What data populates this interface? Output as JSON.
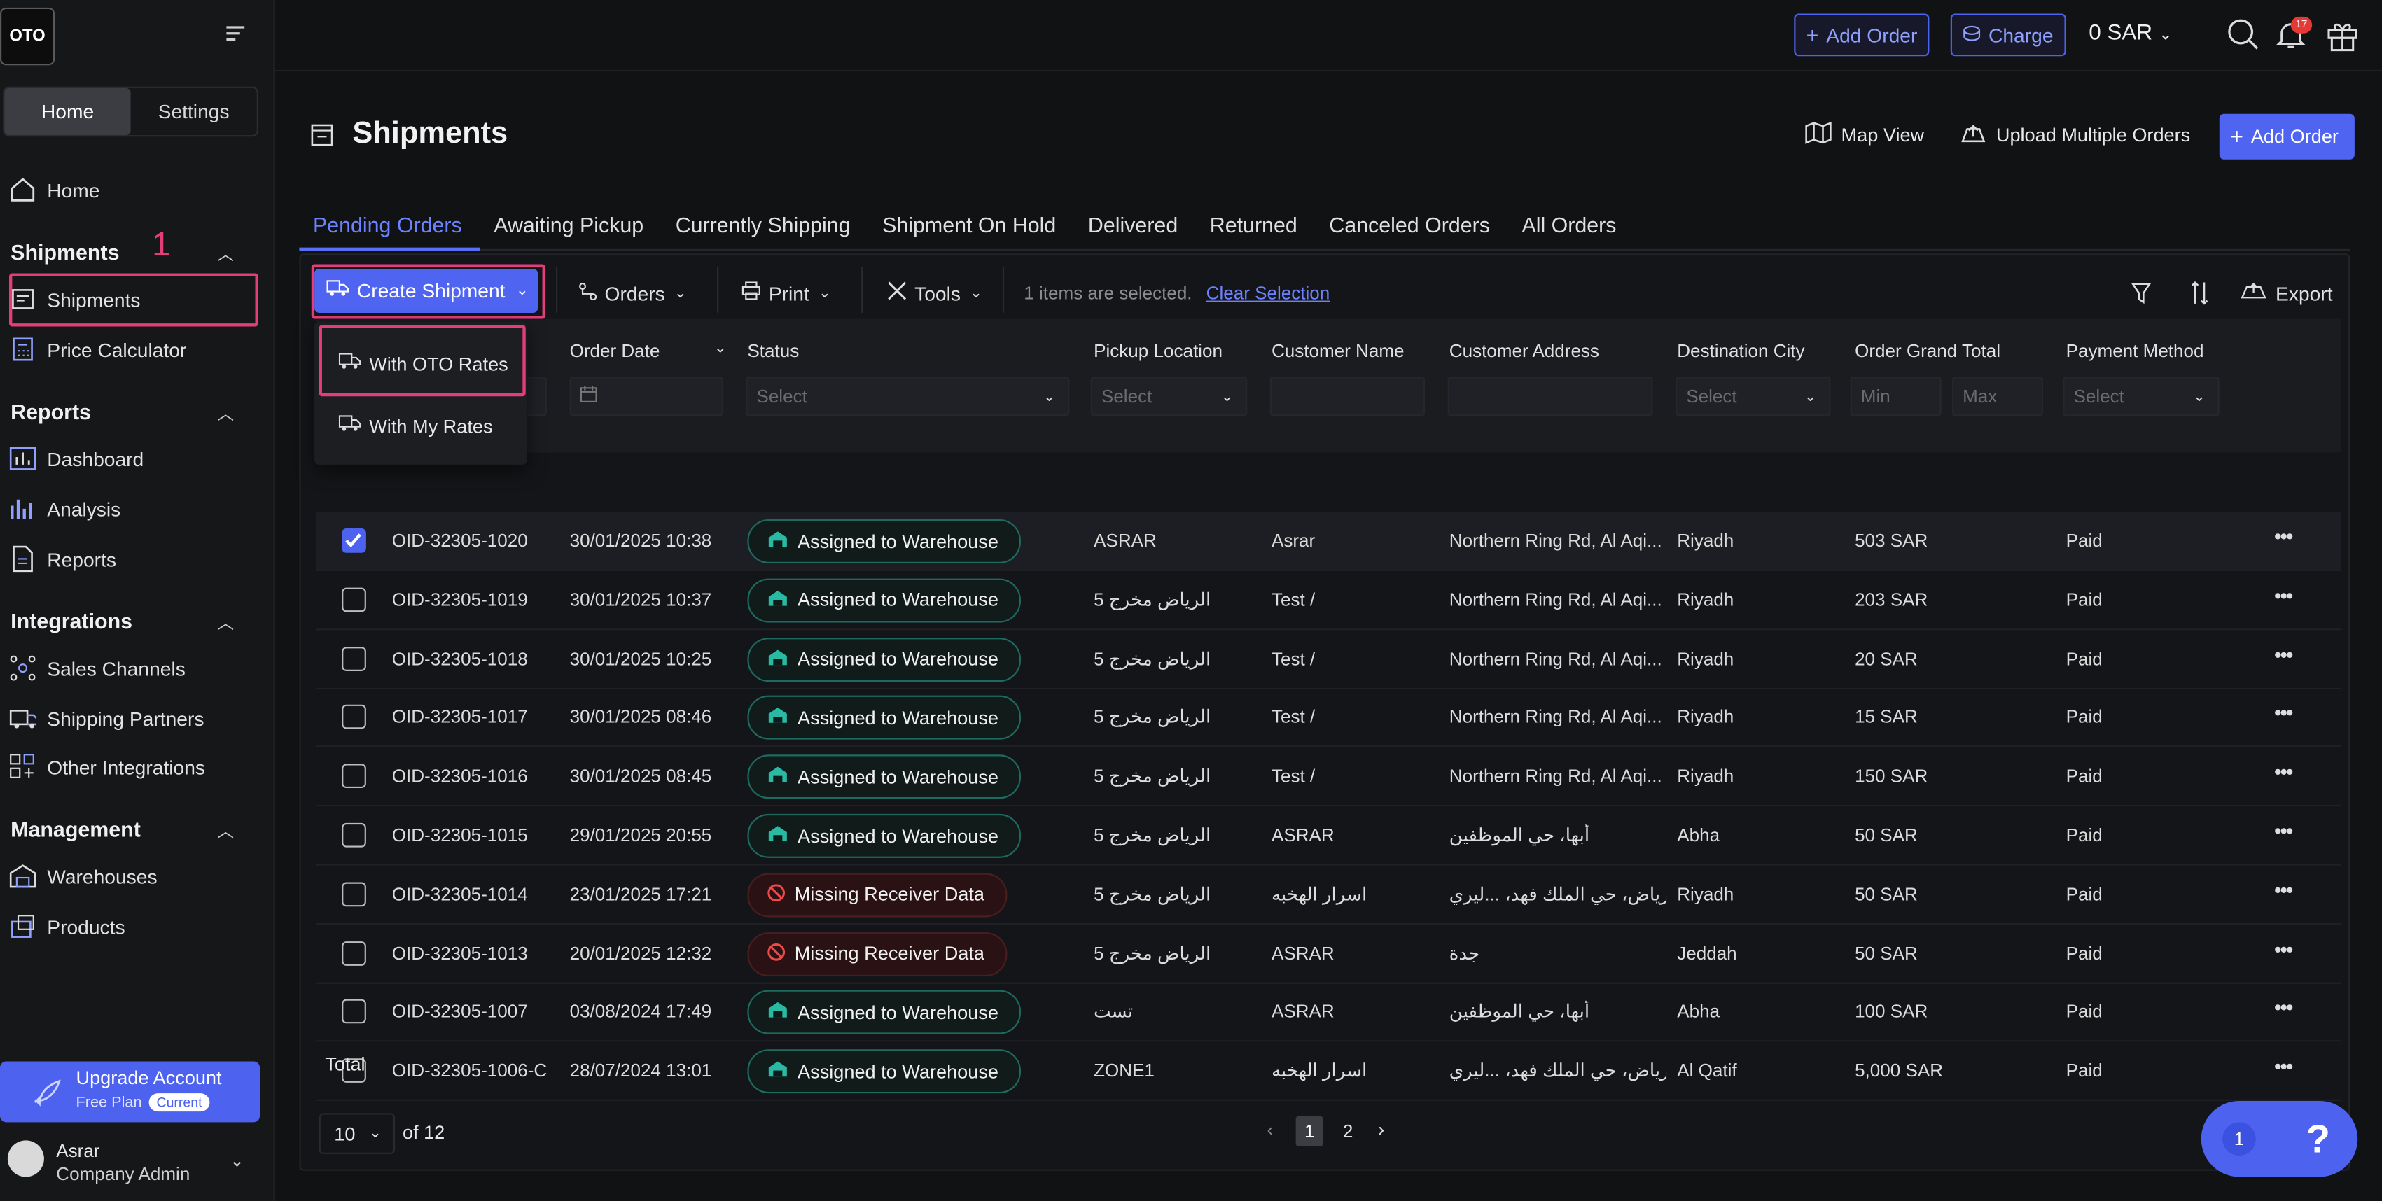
{
  "app": {
    "logo": "OTO"
  },
  "sidebar": {
    "tabs": [
      "Home",
      "Settings"
    ],
    "home": "Home",
    "shipments_section": "Shipments",
    "annotation": "1",
    "shipments_items": [
      "Shipments",
      "Price Calculator"
    ],
    "reports_section": "Reports",
    "reports_items": [
      "Dashboard",
      "Analysis",
      "Reports"
    ],
    "integrations_section": "Integrations",
    "integrations_items": [
      "Sales Channels",
      "Shipping Partners",
      "Other Integrations"
    ],
    "management_section": "Management",
    "management_items": [
      "Warehouses",
      "Products"
    ],
    "upgrade": {
      "title": "Upgrade Account",
      "plan": "Free Plan",
      "tag": "Current"
    },
    "user": {
      "name": "Asrar",
      "role": "Company Admin"
    }
  },
  "topbar": {
    "add_order": "Add Order",
    "charge": "Charge",
    "balance": "0 SAR",
    "notif_count": "17"
  },
  "page": {
    "title": "Shipments",
    "map_view": "Map View",
    "upload": "Upload Multiple Orders",
    "add_order": "Add Order"
  },
  "tabs": [
    "Pending Orders",
    "Awaiting Pickup",
    "Currently Shipping",
    "Shipment On Hold",
    "Delivered",
    "Returned",
    "Canceled Orders",
    "All Orders"
  ],
  "toolbar": {
    "create": "Create Shipment",
    "orders": "Orders",
    "print": "Print",
    "tools": "Tools",
    "selected": "1 items are selected.",
    "clear": "Clear Selection",
    "export": "Export"
  },
  "dropdown": {
    "oto": "With OTO Rates",
    "mine": "With My Rates"
  },
  "columns": {
    "order_date": "Order Date",
    "status": "Status",
    "pickup": "Pickup Location",
    "customer": "Customer Name",
    "address": "Customer Address",
    "city": "Destination City",
    "total": "Order Grand Total",
    "payment": "Payment Method"
  },
  "filters": {
    "select": "Select",
    "min": "Min",
    "max": "Max"
  },
  "rows": [
    {
      "id": "OID-32305-1020",
      "date": "30/01/2025 10:38",
      "status": "Assigned to Warehouse",
      "pickup": "ASRAR",
      "customer": "Asrar",
      "address": "Northern Ring Rd, Al Aqi...",
      "city": "Riyadh",
      "total": "503 SAR",
      "pay": "Paid"
    },
    {
      "id": "OID-32305-1019",
      "date": "30/01/2025 10:37",
      "status": "Assigned to Warehouse",
      "pickup": "الرياض مخرج 5",
      "customer": "Test /",
      "address": "Northern Ring Rd, Al Aqi...",
      "city": "Riyadh",
      "total": "203 SAR",
      "pay": "Paid"
    },
    {
      "id": "OID-32305-1018",
      "date": "30/01/2025 10:25",
      "status": "Assigned to Warehouse",
      "pickup": "الرياض مخرج 5",
      "customer": "Test /",
      "address": "Northern Ring Rd, Al Aqi...",
      "city": "Riyadh",
      "total": "20 SAR",
      "pay": "Paid"
    },
    {
      "id": "OID-32305-1017",
      "date": "30/01/2025 08:46",
      "status": "Assigned to Warehouse",
      "pickup": "الرياض مخرج 5",
      "customer": "Test /",
      "address": "Northern Ring Rd, Al Aqi...",
      "city": "Riyadh",
      "total": "15 SAR",
      "pay": "Paid"
    },
    {
      "id": "OID-32305-1016",
      "date": "30/01/2025 08:45",
      "status": "Assigned to Warehouse",
      "pickup": "الرياض مخرج 5",
      "customer": "Test /",
      "address": "Northern Ring Rd, Al Aqi...",
      "city": "Riyadh",
      "total": "150 SAR",
      "pay": "Paid"
    },
    {
      "id": "OID-32305-1015",
      "date": "29/01/2025 20:55",
      "status": "Assigned to Warehouse",
      "pickup": "الرياض مخرج 5",
      "customer": "ASRAR",
      "address": "أبها، حي الموظفين",
      "city": "Abha",
      "total": "50 SAR",
      "pay": "Paid"
    },
    {
      "id": "OID-32305-1014",
      "date": "23/01/2025 17:21",
      "status": "Missing Receiver Data",
      "pickup": "الرياض مخرج 5",
      "customer": "اسرار الهخبه",
      "address": "الرياض، حي الملك فهد، ...ليري",
      "city": "Riyadh",
      "total": "50 SAR",
      "pay": "Paid"
    },
    {
      "id": "OID-32305-1013",
      "date": "20/01/2025 12:32",
      "status": "Missing Receiver Data",
      "pickup": "الرياض مخرج 5",
      "customer": "ASRAR",
      "address": "جدة",
      "city": "Jeddah",
      "total": "50 SAR",
      "pay": "Paid"
    },
    {
      "id": "OID-32305-1007",
      "date": "03/08/2024 17:49",
      "status": "Assigned to Warehouse",
      "pickup": "تست",
      "customer": "ASRAR",
      "address": "أبها، حي الموظفين",
      "city": "Abha",
      "total": "100 SAR",
      "pay": "Paid"
    },
    {
      "id": "OID-32305-1006-C",
      "date": "28/07/2024 13:01",
      "status": "Assigned to Warehouse",
      "pickup": "ZONE1",
      "customer": "اسرار الهخبه",
      "address": "الرياض، حي الملك فهد، ...ليري",
      "city": "Al Qatif",
      "total": "5,000 SAR",
      "pay": "Paid"
    }
  ],
  "footer": {
    "total": "Total",
    "page_size": "10",
    "of": "of 12",
    "pages": [
      "1",
      "2"
    ]
  },
  "help": {
    "count": "1",
    "label": "?"
  }
}
